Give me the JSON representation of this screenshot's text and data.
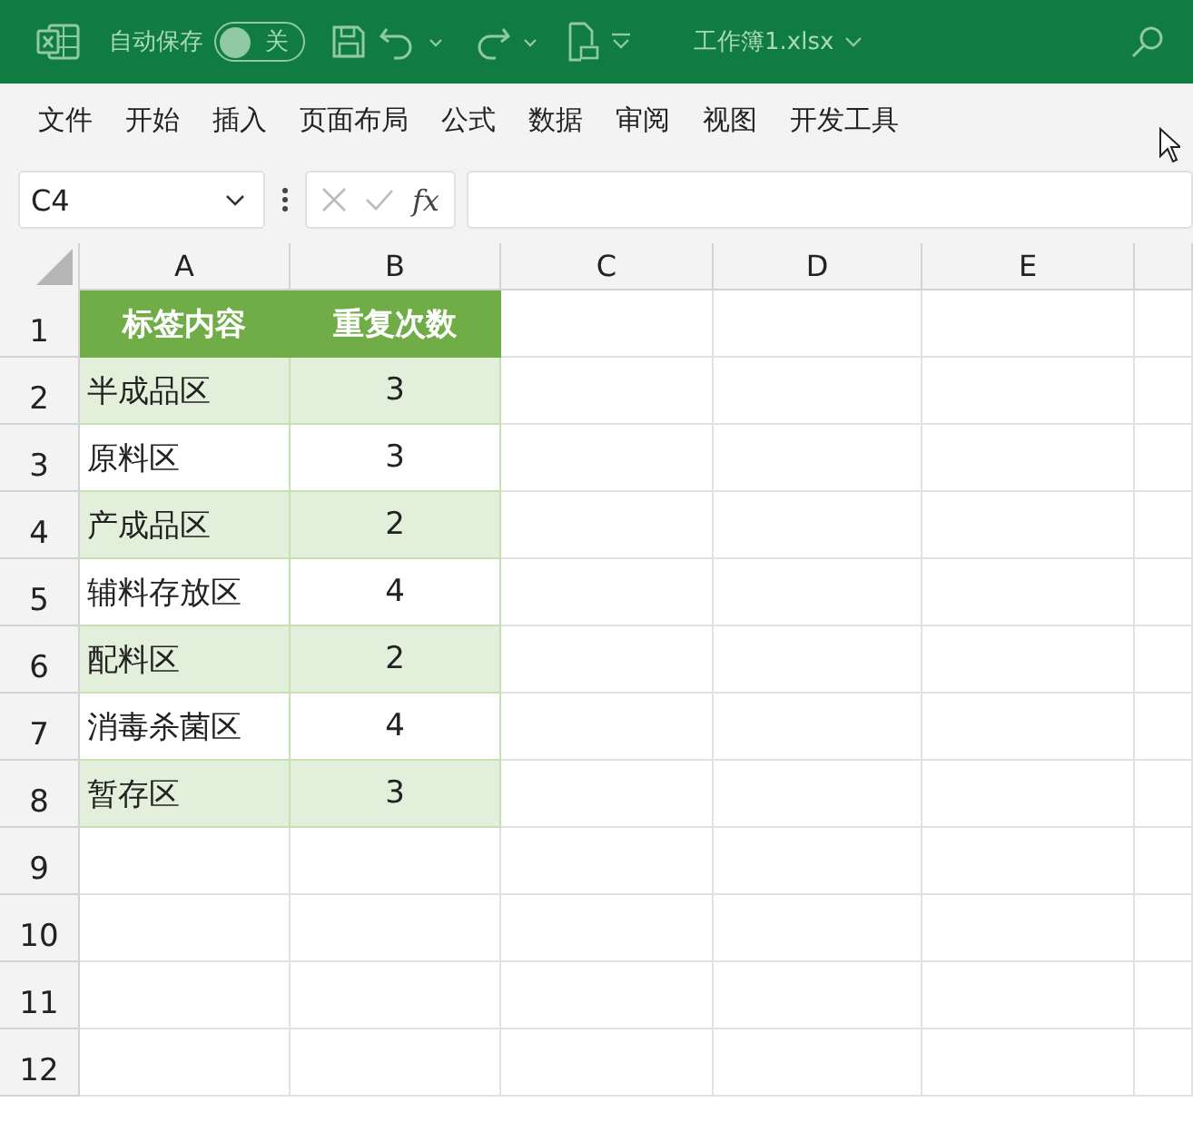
{
  "title_bar": {
    "autosave_label": "自动保存",
    "autosave_toggle": {
      "label": "关",
      "on": false
    },
    "file_name": "工作簿1.xlsx"
  },
  "ribbon_tabs": [
    "文件",
    "开始",
    "插入",
    "页面布局",
    "公式",
    "数据",
    "审阅",
    "视图",
    "开发工具"
  ],
  "formula_bar": {
    "name_box": "C4",
    "fx": "fx"
  },
  "sheet": {
    "columns": [
      "A",
      "B",
      "C",
      "D",
      "E"
    ],
    "row_numbers": [
      "1",
      "2",
      "3",
      "4",
      "5",
      "6",
      "7",
      "8",
      "9",
      "10",
      "11",
      "12"
    ],
    "table": {
      "header": [
        "标签内容",
        "重复次数"
      ],
      "rows": [
        {
          "label": "半成品区",
          "count": "3"
        },
        {
          "label": "原料区",
          "count": "3"
        },
        {
          "label": "产成品区",
          "count": "2"
        },
        {
          "label": "辅料存放区",
          "count": "4"
        },
        {
          "label": "配料区",
          "count": "2"
        },
        {
          "label": "消毒杀菌区",
          "count": "4"
        },
        {
          "label": "暂存区",
          "count": "3"
        }
      ]
    }
  }
}
